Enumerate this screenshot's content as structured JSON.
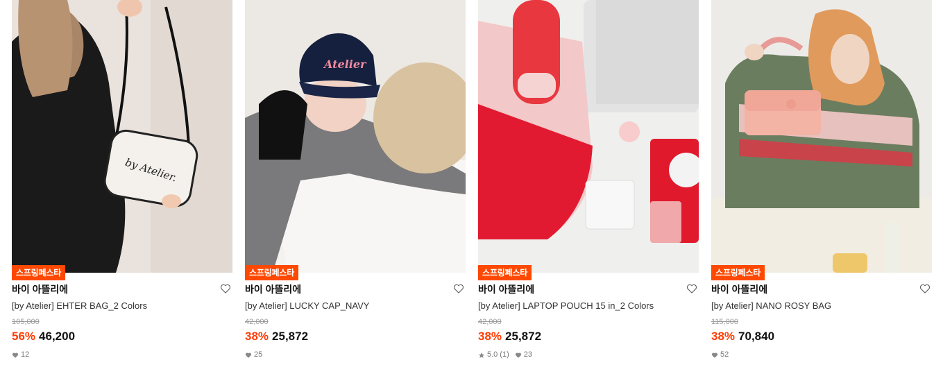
{
  "products": [
    {
      "badge": "스프링페스타",
      "brand": "바이 아뜰리에",
      "name": "[by Atelier] EHTER BAG_2 Colors",
      "original_price": "105,000",
      "discount": "56%",
      "price": "46,200",
      "rating": "",
      "review_count": "",
      "likes": "12",
      "image_icon": "handbag-white-photo"
    },
    {
      "badge": "스프링페스타",
      "brand": "바이 아뜰리에",
      "name": "[by Atelier] LUCKY CAP_NAVY",
      "original_price": "42,000",
      "discount": "38%",
      "price": "25,872",
      "rating": "",
      "review_count": "",
      "likes": "25",
      "image_icon": "navy-cap-photo",
      "image_text": "Atelier"
    },
    {
      "badge": "스프링페스타",
      "brand": "바이 아뜰리에",
      "name": "[by Atelier] LAPTOP POUCH 15 in_2 Colors",
      "original_price": "42,000",
      "discount": "38%",
      "price": "25,872",
      "rating": "5.0",
      "review_count": "(1)",
      "likes": "23",
      "image_icon": "laptop-pouch-photo"
    },
    {
      "badge": "스프링페스타",
      "brand": "바이 아뜰리에",
      "name": "[by Atelier] NANO ROSY BAG",
      "original_price": "115,000",
      "discount": "38%",
      "price": "70,840",
      "rating": "",
      "review_count": "",
      "likes": "52",
      "image_icon": "pink-bag-photo"
    }
  ],
  "colors": {
    "badge_bg": "#ff4800",
    "discount": "#ff3b00",
    "price": "#111111",
    "strike": "#9a9a9a"
  }
}
